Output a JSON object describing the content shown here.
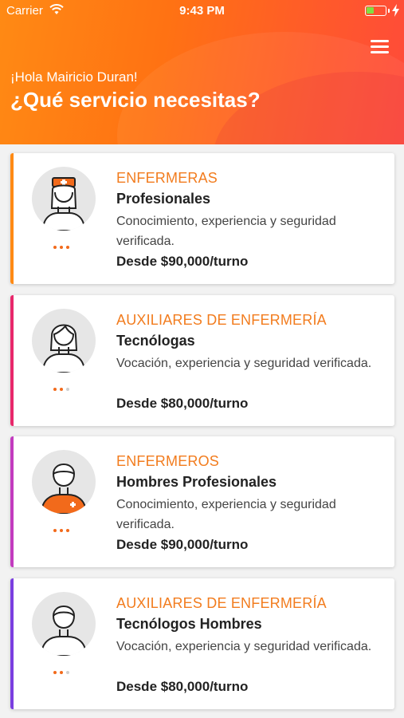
{
  "status_bar": {
    "carrier": "Carrier",
    "time": "9:43 PM"
  },
  "header": {
    "greeting": "¡Hola Mairicio Duran!",
    "title": "¿Qué servicio necesitas?",
    "menu_icon": "hamburger-menu-icon"
  },
  "colors": {
    "header_gradient": [
      "#ff8a14",
      "#ff4a3a"
    ],
    "accent_orange": "#f27c1e",
    "stripes": [
      "#ff8a14",
      "#e8286b",
      "#c23bbf",
      "#7a3fe0"
    ]
  },
  "services": [
    {
      "category": "ENFERMERAS",
      "subtitle": "Profesionales",
      "description": "Conocimiento, experiencia y seguridad verificada.",
      "price": "Desde $90,000/turno",
      "avatar": "nurse-female-icon"
    },
    {
      "category": "AUXILIARES DE ENFERMERÍA",
      "subtitle": "Tecnólogas",
      "description": "Vocación, experiencia y seguridad verificada.",
      "price": "Desde $80,000/turno",
      "avatar": "assistant-female-icon"
    },
    {
      "category": "ENFERMEROS",
      "subtitle": "Hombres Profesionales",
      "description": "Conocimiento, experiencia y seguridad verificada.",
      "price": "Desde $90,000/turno",
      "avatar": "nurse-male-icon"
    },
    {
      "category": "AUXILIARES DE ENFERMERÍA",
      "subtitle": "Tecnólogos Hombres",
      "description": "Vocación, experiencia y seguridad verificada.",
      "price": "Desde $80,000/turno",
      "avatar": "assistant-male-icon"
    }
  ]
}
